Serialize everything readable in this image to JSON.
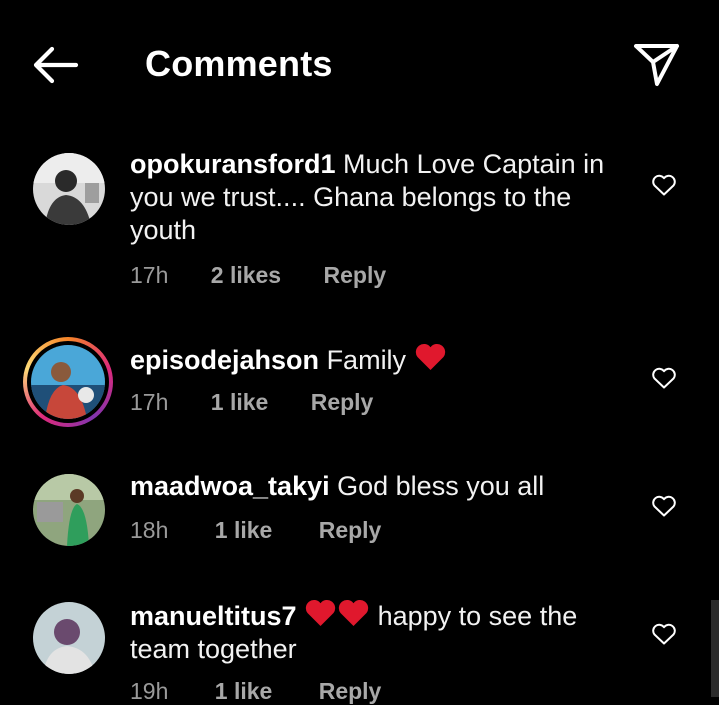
{
  "header": {
    "title": "Comments",
    "back_icon": "arrow-left-icon",
    "share_icon": "paper-plane-icon"
  },
  "colors": {
    "background": "#000000",
    "text": "#ffffff",
    "muted": "#9a9a9a",
    "heart": "#e0182d"
  },
  "comments": [
    {
      "username": "opokuransford1",
      "text": "Much Love Captain in you we trust.... Ghana belongs to the youth",
      "time": "17h",
      "likes": "2 likes",
      "reply": "Reply",
      "has_story_ring": false
    },
    {
      "username": "episodejahson",
      "text": "Family",
      "emoji": "red-heart",
      "time": "17h",
      "likes": "1 like",
      "reply": "Reply",
      "has_story_ring": true
    },
    {
      "username": "maadwoa_takyi",
      "text": "God bless you all",
      "time": "18h",
      "likes": "1 like",
      "reply": "Reply",
      "has_story_ring": false
    },
    {
      "username": "manueltitus7",
      "emoji": "two-red-hearts",
      "text": "happy to see the team together",
      "time": "19h",
      "likes": "1 like",
      "reply": "Reply",
      "has_story_ring": false
    }
  ]
}
